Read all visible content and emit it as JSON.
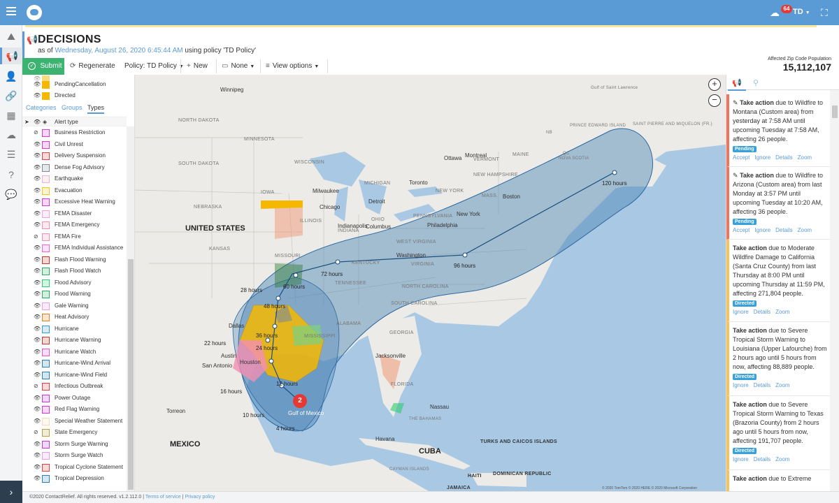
{
  "topbar": {
    "badge_count": "64",
    "user": "TD"
  },
  "header": {
    "title": "DECISIONS",
    "asof_prefix": "as of",
    "asof_date": "Wednesday, August 26, 2020 6:45:44 AM",
    "asof_suffix": "using policy 'TD Policy'"
  },
  "toolbar": {
    "submit": "Submit",
    "regenerate": "Regenerate",
    "policy": "Policy: TD Policy",
    "new": "New",
    "none": "None",
    "view_options": "View options",
    "zip_label": "Affected Zip Code Population",
    "zip_value": "15,112,107"
  },
  "panel": {
    "status_items": [
      {
        "label": "PendingCancellation",
        "color": "#f5b700"
      },
      {
        "label": "Directed",
        "color": "#f5b700"
      }
    ],
    "tabs": [
      "Categories",
      "Groups",
      "Types"
    ],
    "active_tab": "Types",
    "type_header": "Alert type",
    "types": [
      {
        "label": "Business Restriction",
        "color": "#d63ad6"
      },
      {
        "label": "Civil Unrest",
        "color": "#d63ad6"
      },
      {
        "label": "Delivery Suspension",
        "color": "#e04040"
      },
      {
        "label": "Dense Fog Advisory",
        "color": "#7a8a99"
      },
      {
        "label": "Earthquake",
        "color": "#f4b3c2"
      },
      {
        "label": "Evacuation",
        "color": "#f5c518"
      },
      {
        "label": "Excessive Heat Warning",
        "color": "#d63ad6"
      },
      {
        "label": "FEMA Disaster",
        "color": "#f4a3d6"
      },
      {
        "label": "FEMA Emergency",
        "color": "#f48fb1"
      },
      {
        "label": "FEMA Fire",
        "color": "#f48fb1"
      },
      {
        "label": "FEMA Individual Assistance",
        "color": "#e36ad6"
      },
      {
        "label": "Flash Flood Warning",
        "color": "#c0392b"
      },
      {
        "label": "Flash Flood Watch",
        "color": "#27ae60"
      },
      {
        "label": "Flood Advisory",
        "color": "#2ecc71"
      },
      {
        "label": "Flood Warning",
        "color": "#27ae60"
      },
      {
        "label": "Gale Warning",
        "color": "#e5a0e5"
      },
      {
        "label": "Heat Advisory",
        "color": "#e67e22"
      },
      {
        "label": "Hurricane",
        "color": "#3498db"
      },
      {
        "label": "Hurricane Warning",
        "color": "#c0392b"
      },
      {
        "label": "Hurricane Watch",
        "color": "#e056d6"
      },
      {
        "label": "Hurricane-Wind Arrival",
        "color": "#2980b9"
      },
      {
        "label": "Hurricane-Wind Field",
        "color": "#2980b9"
      },
      {
        "label": "Infectious Outbreak",
        "color": "#e04040"
      },
      {
        "label": "Power Outage",
        "color": "#c03ad6"
      },
      {
        "label": "Red Flag Warning",
        "color": "#d63ad6"
      },
      {
        "label": "Special Weather Statement",
        "color": "#f5deb3"
      },
      {
        "label": "State Emergency",
        "color": "#b8a040"
      },
      {
        "label": "Storm Surge Warning",
        "color": "#c03ad6"
      },
      {
        "label": "Storm Surge Watch",
        "color": "#e5a0e5"
      },
      {
        "label": "Tropical Cyclone Statement",
        "color": "#e04040"
      },
      {
        "label": "Tropical Depression",
        "color": "#2980b9"
      }
    ]
  },
  "map": {
    "big_labels": [
      "UNITED STATES",
      "MEXICO",
      "CUBA"
    ],
    "gulf": "Gulf of Mexico",
    "storm_number": "2",
    "hours": [
      "4 hours",
      "10 hours",
      "16 hours",
      "22 hours",
      "28 hours",
      "12 hours",
      "24 hours",
      "36 hours",
      "48 hours",
      "60 hours",
      "72 hours",
      "96 hours",
      "120 hours"
    ],
    "states": [
      "NORTH DAKOTA",
      "MINNESOTA",
      "SOUTH DAKOTA",
      "WISCONSIN",
      "IOWA",
      "NEBRASKA",
      "ILLINOIS",
      "INDIANA",
      "OHIO",
      "MICHIGAN",
      "KANSAS",
      "MISSOURI",
      "KENTUCKY",
      "TENNESSEE",
      "VIRGINIA",
      "WEST VIRGINIA",
      "NORTH CAROLINA",
      "SOUTH CAROLINA",
      "ALABAMA",
      "GEORGIA",
      "MISSISSIPPI",
      "FLORIDA",
      "PENNSYLVANIA",
      "NEW YORK",
      "MAINE",
      "VERMONT",
      "NEW HAMPSHIRE",
      "MASS."
    ],
    "cities": [
      "Winnipeg",
      "Milwaukee",
      "Chicago",
      "Detroit",
      "Toronto",
      "Ottawa",
      "Montreal",
      "Boston",
      "New York",
      "Philadelphia",
      "Washington",
      "Indianapolis",
      "Columbus",
      "Dallas",
      "Houston",
      "Austin",
      "San Antonio",
      "Jacksonville",
      "Torreon",
      "Nassau",
      "Havana"
    ],
    "regions": [
      "NOVA SCOTIA",
      "PRINCE EDWARD ISLAND",
      "NB",
      "QC",
      "THE BAHAMAS",
      "TURKS AND CAICOS ISLANDS",
      "DOMINICAN REPUBLIC",
      "HAITI",
      "JAMAICA",
      "CAYMAN ISLANDS",
      "SAINT PIERRE AND MIQUELON (FR.)",
      "Gulf of Saint Lawrence"
    ],
    "copyright": "© 2020 TomTom © 2020 HERE © 2020 Microsoft Corporation"
  },
  "rpanel": {
    "cards": [
      {
        "lead": "Take action",
        "text": " due to Wildfire to Montana (Custom area) from yesterday at 7:58 AM until upcoming Tuesday at 7:58 AM, affecting 26 people.",
        "tag": "Pending",
        "actions": [
          "Accept",
          "Ignore",
          "Details",
          "Zoom"
        ],
        "border": "#f0735a",
        "tag_color": "#3aa0d8"
      },
      {
        "lead": "Take action",
        "text": " due to Wildfire to Arizona (Custom area) from last Monday at 3:57 PM until upcoming Tuesday at 10:20 AM, affecting 36 people.",
        "tag": "Pending",
        "actions": [
          "Accept",
          "Ignore",
          "Details",
          "Zoom"
        ],
        "border": "#f0735a",
        "tag_color": "#3aa0d8"
      },
      {
        "lead": "Take action",
        "text": " due to Moderate Wildfire Damage to California (Santa Cruz County) from last Thursday at 8:00 PM until upcoming Thursday at 11:59 PM, affecting 271,804 people.",
        "tag": "Directed",
        "actions": [
          "Ignore",
          "Details",
          "Zoom"
        ],
        "border": "#f7c35c",
        "tag_color": "#3aa0d8"
      },
      {
        "lead": "Take action",
        "text": " due to Severe Tropical Storm Warning to Louisiana (Upper Lafourche) from 2 hours ago until 5 hours from now, affecting 88,889 people.",
        "tag": "Directed",
        "actions": [
          "Ignore",
          "Details",
          "Zoom"
        ],
        "border": "#f7c35c",
        "tag_color": "#3aa0d8"
      },
      {
        "lead": "Take action",
        "text": " due to Severe Tropical Storm Warning to Texas (Brazoria County) from 2 hours ago until 5 hours from now, affecting 191,707 people.",
        "tag": "Directed",
        "actions": [
          "Ignore",
          "Details",
          "Zoom"
        ],
        "border": "#f7c35c",
        "tag_color": "#3aa0d8"
      },
      {
        "lead": "Take action",
        "text": " due to Extreme",
        "tag": "",
        "actions": [],
        "border": "#f7c35c",
        "tag_color": "#3aa0d8"
      }
    ]
  },
  "footer": {
    "copy": "©2020 ContactRelief. All rights reserved. v1.2.112.0 |",
    "terms": "Terms of service",
    "sep": "|",
    "privacy": "Privacy policy"
  }
}
